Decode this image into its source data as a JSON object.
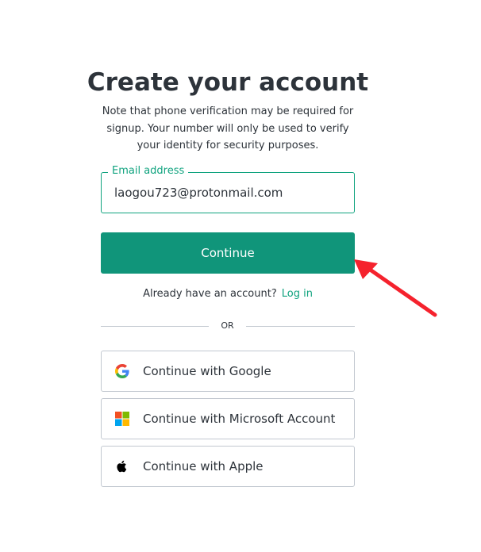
{
  "header": {
    "title": "Create your account",
    "subtitle": "Note that phone verification may be required for signup. Your number will only be used to verify your identity for security purposes."
  },
  "email": {
    "label": "Email address",
    "value": "laogou723@protonmail.com"
  },
  "continue_button": {
    "label": "Continue"
  },
  "login_prompt": {
    "text": "Already have an account?",
    "link": "Log in"
  },
  "divider": {
    "text": "OR"
  },
  "social_buttons": [
    {
      "label": "Continue with Google",
      "icon": "google-icon"
    },
    {
      "label": "Continue with Microsoft Account",
      "icon": "microsoft-icon"
    },
    {
      "label": "Continue with Apple",
      "icon": "apple-icon"
    }
  ],
  "colors": {
    "accent": "#10a37f",
    "button": "#10957a",
    "text": "#2d333a",
    "border": "#c2c8d0",
    "annotation_arrow": "#f5222d"
  }
}
